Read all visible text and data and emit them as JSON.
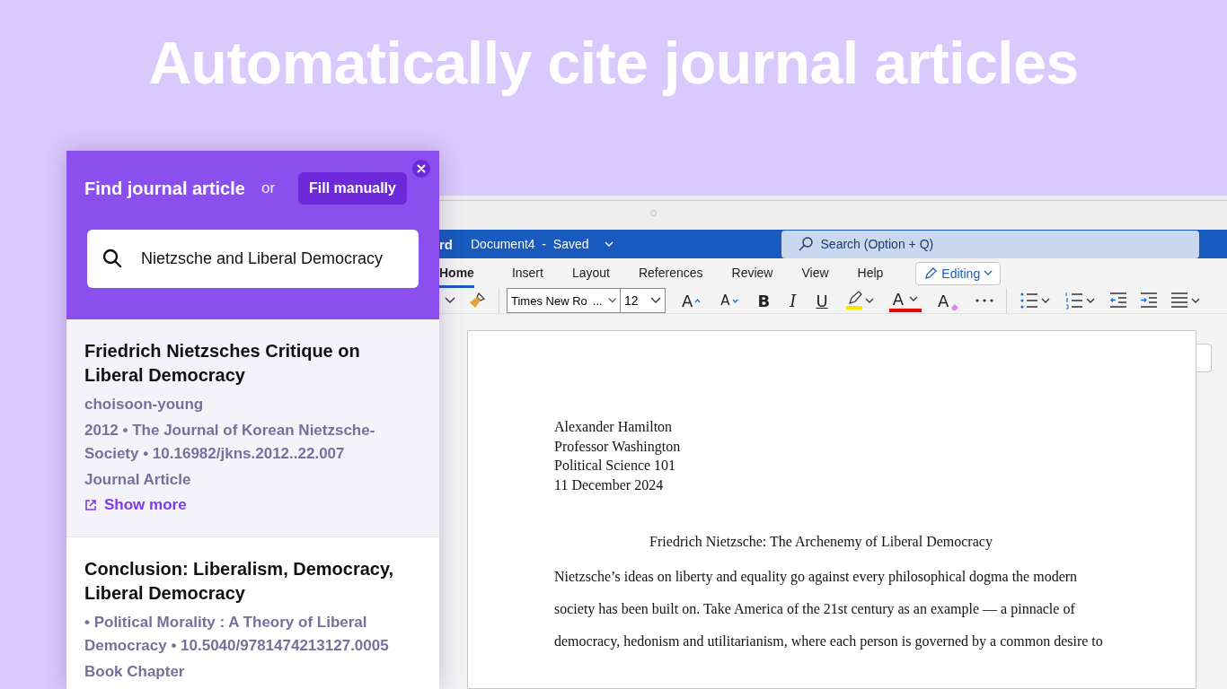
{
  "headline": "Automatically cite journal articles",
  "word": {
    "app_name": "rd",
    "document_title": "Document4  -  Saved",
    "search": {
      "placeholder": "Search (Option + Q)"
    },
    "tabs": [
      {
        "label": "Home",
        "selected": true
      },
      {
        "label": "Insert",
        "selected": false
      },
      {
        "label": "Layout",
        "selected": false
      },
      {
        "label": "References",
        "selected": false
      },
      {
        "label": "Review",
        "selected": false
      },
      {
        "label": "View",
        "selected": false
      },
      {
        "label": "Help",
        "selected": false
      }
    ],
    "mode_button": "Editing",
    "font": {
      "name": "Times New Ro",
      "ellipsis": "...",
      "size": "12"
    },
    "toolbar": [
      {
        "kind": "grow",
        "label": "A"
      },
      {
        "kind": "shrink",
        "label": "A"
      },
      {
        "kind": "bold",
        "label": "B"
      },
      {
        "kind": "italic",
        "label": "I"
      },
      {
        "kind": "underline",
        "label": "U"
      },
      {
        "kind": "highlight"
      },
      {
        "kind": "fontcolor",
        "label": "A"
      },
      {
        "kind": "clear",
        "label": "A"
      },
      {
        "kind": "more"
      },
      {
        "kind": "bullets"
      },
      {
        "kind": "numbering"
      },
      {
        "kind": "outdent"
      },
      {
        "kind": "indent"
      },
      {
        "kind": "align"
      }
    ],
    "document": {
      "header_lines": [
        "Alexander Hamilton",
        "Professor Washington",
        "Political Science 101",
        "11 December 2024"
      ],
      "title": "Friedrich Nietzsche: The Archenemy of Liberal Democracy",
      "body_lines": [
        "Nietzsche’s ideas on liberty and equality go against every philosophical dogma the modern",
        "society has been built on. Take America of the 21st century as an example — a pinnacle of",
        "democracy, hedonism and utilitarianism, where each person is governed by a common desire to"
      ]
    }
  },
  "panel": {
    "title": "Find journal article",
    "or": "or",
    "fill_button": "Fill manually",
    "search": {
      "value": "Nietzsche and Liberal Democracy"
    },
    "results": [
      {
        "title": "Friedrich Nietzsches Critique on Liberal Democracy",
        "selected": true,
        "meta": [
          "choisoon-young",
          "2012 • The Journal of Korean Nietzsche-Society • 10.16982/jkns.2012..22.007",
          "Journal Article"
        ],
        "link": "Show more"
      },
      {
        "title": "Conclusion: Liberalism, Democracy, Liberal Democracy",
        "selected": false,
        "meta": [
          "• Political Morality : A Theory of Liberal Democracy • 10.5040/9781474213127.0005",
          "Book Chapter"
        ]
      }
    ]
  }
}
